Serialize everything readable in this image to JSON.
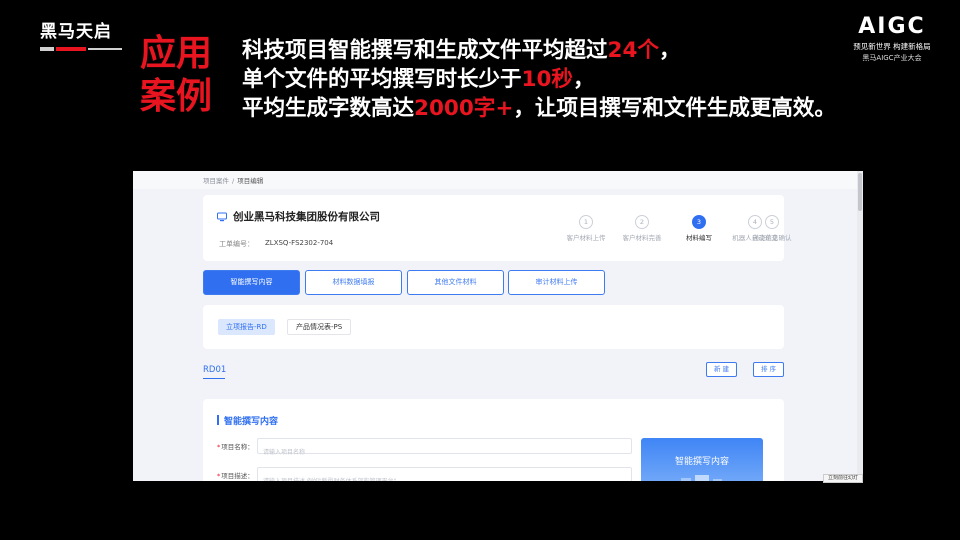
{
  "brand_left": {
    "name": "黑马天启"
  },
  "heading_red": "应用案例",
  "headline": {
    "line1_pre": "科技项目智能撰写和生成文件平均超过",
    "line1_hl": "24个",
    "line1_post": "，",
    "line2_pre": "单个文件的平均撰写时长少于",
    "line2_hl": "10秒",
    "line2_post": "，",
    "line3_pre": "平均生成字数高达",
    "line3_hl": "2000字+",
    "line3_post": "，让项目撰写和文件生成更高效。"
  },
  "brand_right": {
    "name": "AIGC",
    "tagline": "预见新世界 构建新格局",
    "event": "黑马AIGC产业大会"
  },
  "screenshot": {
    "breadcrumb": [
      "项目案件",
      "项目编辑"
    ],
    "company": {
      "name": "创业黑马科技集团股份有限公司",
      "order_label": "工单编号：",
      "order_value": "ZLXSQ-FS2302-704"
    },
    "steps": [
      {
        "num": "1",
        "label": "客户材料上传"
      },
      {
        "num": "2",
        "label": "客户材料完善"
      },
      {
        "num": "3",
        "label": "材料编写"
      },
      {
        "num": "4",
        "label": "机器人自动递交"
      },
      {
        "num": "5",
        "label": "递交信息确认"
      }
    ],
    "active_step": 3,
    "tabs": [
      "智能撰写内容",
      "材料数据填报",
      "其他文件材料",
      "审计材料上传"
    ],
    "active_tab": "智能撰写内容",
    "doc_tabs": [
      "立项报告-RD",
      "产品情况表-PS"
    ],
    "active_doc_tab": "立项报告-RD",
    "rd_label": "RD01",
    "buttons": {
      "new": "新 建",
      "sort": "排 序"
    },
    "form": {
      "title": "智能撰写内容",
      "fields": [
        {
          "label": "项目名称：",
          "placeholder": "请输入项目名称"
        },
        {
          "label": "项目描述：",
          "placeholder": "请输入项目描述,例如\"新型财务体系架构管理平台\""
        }
      ],
      "ai_button": "智能撰写内容"
    },
    "corner_tip": "立刻前往幻灯"
  }
}
